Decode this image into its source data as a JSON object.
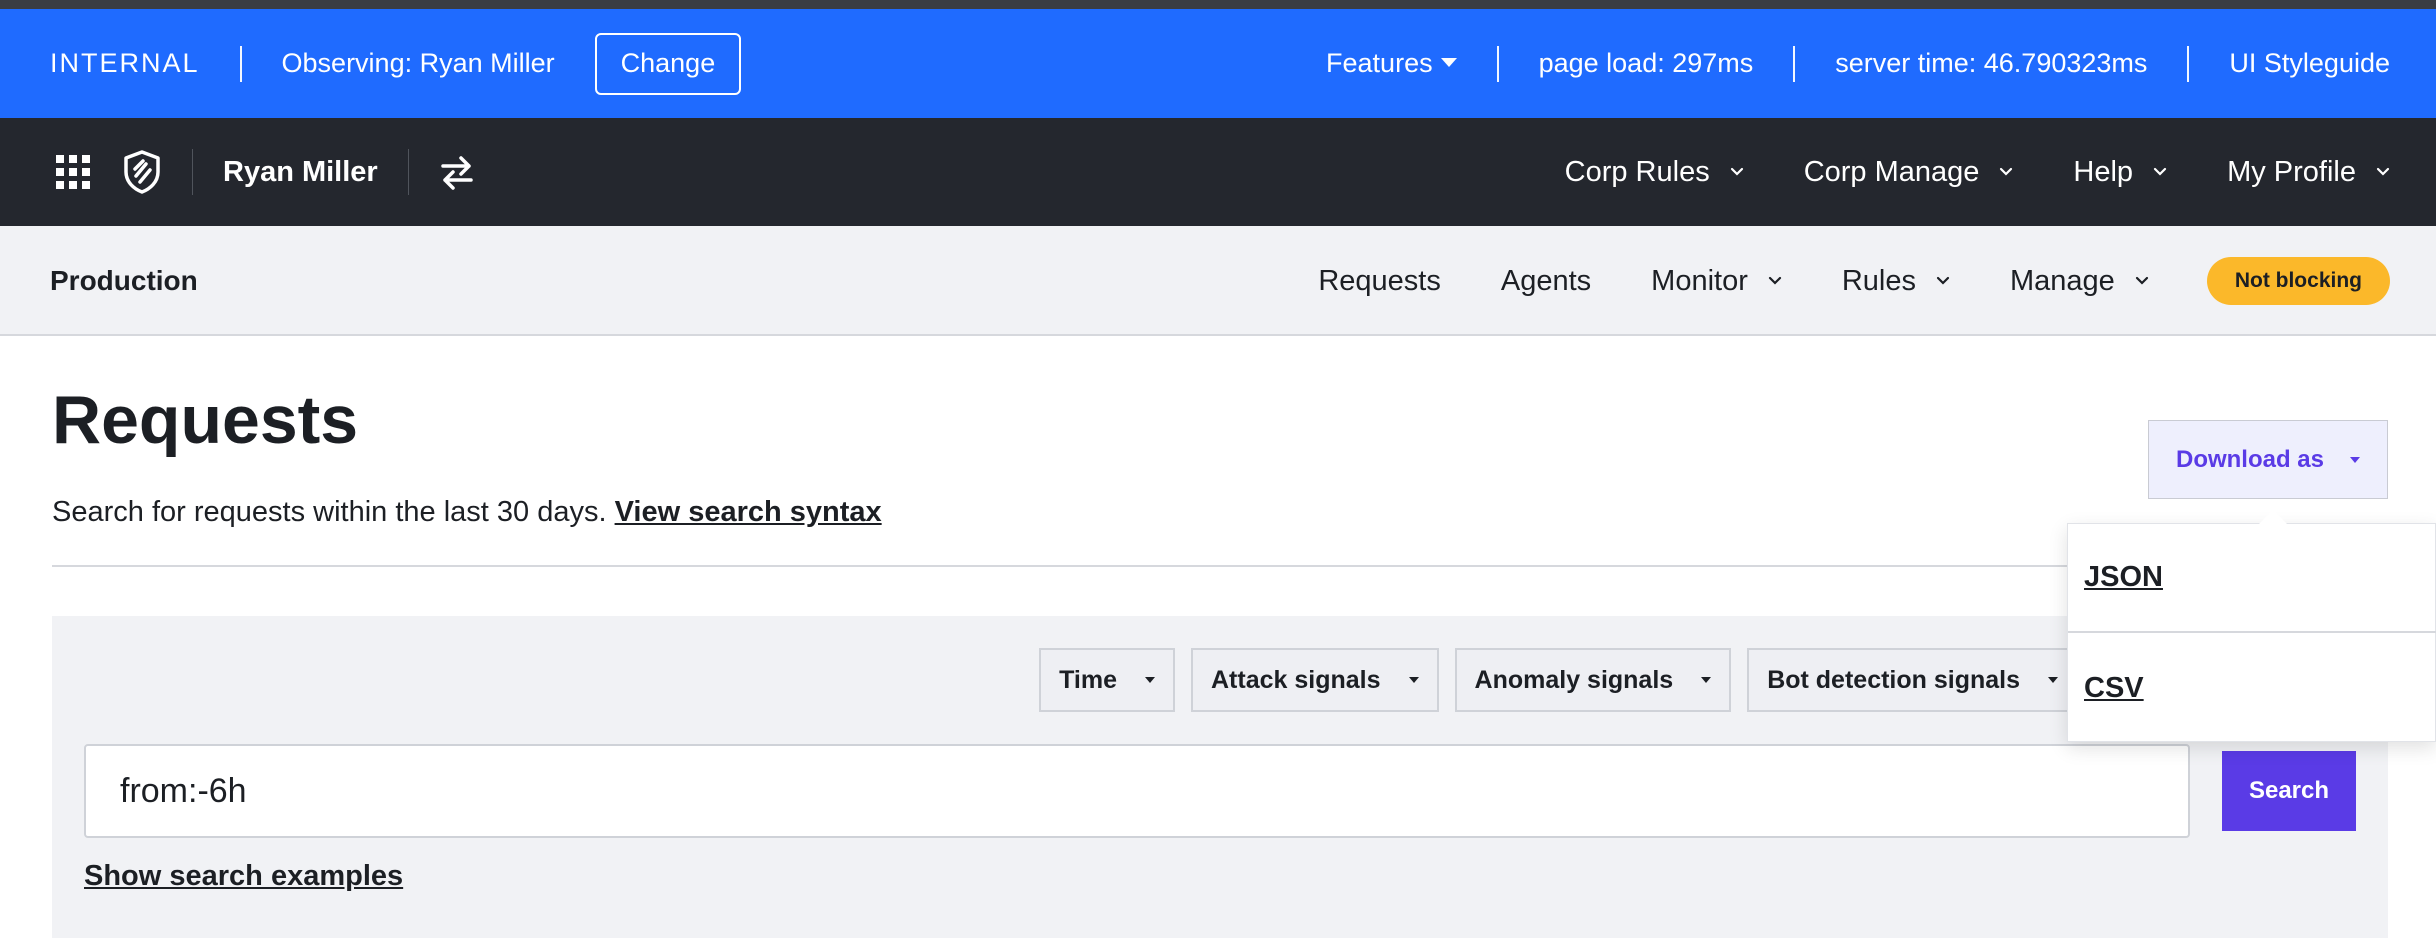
{
  "internal_bar": {
    "label": "INTERNAL",
    "observing": "Observing: Ryan Miller",
    "change_label": "Change",
    "features_label": "Features",
    "page_load": "page load: 297ms",
    "server_time": "server time: 46.790323ms",
    "styleguide_label": "UI Styleguide"
  },
  "main_nav": {
    "user_name": "Ryan Miller",
    "menus": [
      {
        "label": "Corp Rules"
      },
      {
        "label": "Corp Manage"
      },
      {
        "label": "Help"
      },
      {
        "label": "My Profile"
      }
    ]
  },
  "site_nav": {
    "site_name": "Production",
    "links": [
      {
        "label": "Requests"
      },
      {
        "label": "Agents"
      },
      {
        "label": "Monitor"
      },
      {
        "label": "Rules"
      },
      {
        "label": "Manage"
      }
    ],
    "status_badge": "Not blocking"
  },
  "page": {
    "title": "Requests",
    "subtitle": "Search for requests within the last 30 days.",
    "syntax_link": "View search syntax",
    "download_label": "Download as",
    "download_options": [
      "JSON",
      "CSV"
    ]
  },
  "search": {
    "filters": [
      "Time",
      "Attack signals",
      "Anomaly signals",
      "Bot detection signals"
    ],
    "query": "from:-6h",
    "button_label": "Search",
    "examples_link": "Show search examples"
  },
  "colors": {
    "internal_bar": "#1f6bff",
    "dark_nav": "#24272e",
    "accent": "#5a3be6",
    "badge": "#fbb82a"
  }
}
